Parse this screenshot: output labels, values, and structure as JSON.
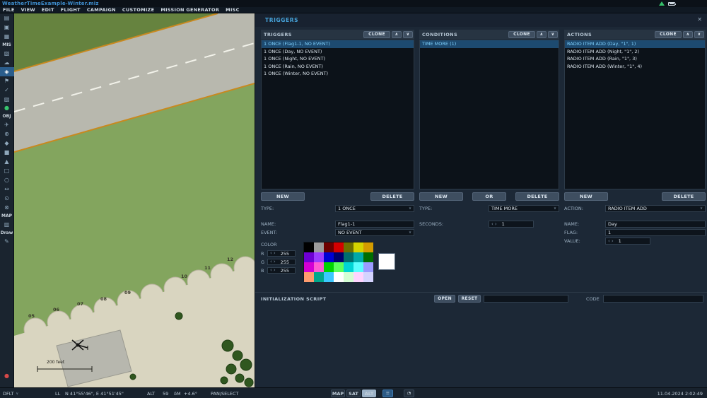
{
  "window": {
    "title": "WeatherTimeExample-Winter.miz"
  },
  "menu": {
    "items": [
      "FILE",
      "VIEW",
      "EDIT",
      "FLIGHT",
      "CAMPAIGN",
      "CUSTOMIZE",
      "MISSION GENERATOR",
      "MISC"
    ]
  },
  "ui": {
    "chevron": "∨",
    "up": "∧",
    "down": "∨",
    "dec": "‹",
    "inc": "›",
    "close": "✕",
    "grid_icon": "≡",
    "clock_icon": "◔"
  },
  "toolbar": {
    "items": [
      {
        "cls": "tb-icon",
        "name": "new-mission-icon",
        "glyph": "▤",
        "inter": "true"
      },
      {
        "cls": "tb-icon",
        "name": "open-mission-icon",
        "glyph": "▣",
        "inter": "true"
      },
      {
        "cls": "tb-icon",
        "name": "save-mission-icon",
        "glyph": "▦",
        "inter": "true"
      },
      {
        "cls": "tb-label",
        "name": "mis-section-label",
        "glyph": "MIS",
        "inter": "false"
      },
      {
        "cls": "tb-icon",
        "name": "briefing-icon",
        "glyph": "▧",
        "inter": "true"
      },
      {
        "cls": "tb-icon",
        "name": "weather-icon",
        "glyph": "☁",
        "inter": "true"
      },
      {
        "cls": "tb-icon-sel",
        "name": "triggers-icon",
        "glyph": "◈",
        "inter": "true"
      },
      {
        "cls": "tb-icon",
        "name": "goals-icon",
        "glyph": "⚑",
        "inter": "true"
      },
      {
        "cls": "tb-icon",
        "name": "checklist-icon",
        "glyph": "✓",
        "inter": "true"
      },
      {
        "cls": "tb-icon",
        "name": "resources-icon",
        "glyph": "▨",
        "inter": "true"
      },
      {
        "cls": "tb-dot-green",
        "name": "validation-status-icon",
        "glyph": "●",
        "inter": "false"
      },
      {
        "cls": "tb-label",
        "name": "obj-section-label",
        "glyph": "OBJ",
        "inter": "false"
      },
      {
        "cls": "tb-icon",
        "name": "aircraft-icon",
        "glyph": "✈",
        "inter": "true"
      },
      {
        "cls": "tb-icon",
        "name": "helicopter-group-icon",
        "glyph": "⊕",
        "inter": "true"
      },
      {
        "cls": "tb-icon",
        "name": "ship-icon",
        "glyph": "◆",
        "inter": "true"
      },
      {
        "cls": "tb-icon",
        "name": "vehicle-icon",
        "glyph": "■",
        "inter": "true"
      },
      {
        "cls": "tb-icon",
        "name": "static-object-icon",
        "glyph": "▲",
        "inter": "true"
      },
      {
        "cls": "tb-icon",
        "name": "template-icon",
        "glyph": "□",
        "inter": "true"
      },
      {
        "cls": "tb-icon",
        "name": "trigger-zone-icon",
        "glyph": "○",
        "inter": "true"
      },
      {
        "cls": "tb-icon",
        "name": "distance-tool-icon",
        "glyph": "↔",
        "inter": "true"
      },
      {
        "cls": "tb-icon",
        "name": "waypoint-icon",
        "glyph": "⊙",
        "inter": "true"
      },
      {
        "cls": "tb-icon",
        "name": "erase-icon",
        "glyph": "⊗",
        "inter": "true"
      },
      {
        "cls": "tb-label",
        "name": "map-section-label",
        "glyph": "MAP",
        "inter": "false"
      },
      {
        "cls": "tb-icon",
        "name": "map-options-icon",
        "glyph": "▥",
        "inter": "true"
      },
      {
        "cls": "tb-label",
        "name": "draw-section-label",
        "glyph": "Draw",
        "inter": "false"
      },
      {
        "cls": "tb-icon",
        "name": "draw-tool-icon",
        "glyph": "✎",
        "inter": "true"
      },
      {
        "cls": "tb-dot-red",
        "name": "record-indicator-icon",
        "glyph": "●",
        "inter": "false"
      }
    ]
  },
  "map": {
    "parking_numbers": [
      "05",
      "06",
      "07",
      "08",
      "09",
      "10",
      "11",
      "12"
    ],
    "scale_label": "200 feet"
  },
  "panel": {
    "title": "TRIGGERS",
    "triggers": {
      "header": "TRIGGERS",
      "clone": "CLONE",
      "items": [
        {
          "label": "1 ONCE (Flag1-1, NO EVENT)",
          "cls": "selected"
        },
        {
          "label": "1 ONCE (Day, NO EVENT)"
        },
        {
          "label": "1 ONCE (Night, NO EVENT)"
        },
        {
          "label": "1 ONCE (Rain, NO EVENT)"
        },
        {
          "label": "1 ONCE (Winter, NO EVENT)"
        }
      ],
      "new": "NEW",
      "delete": "DELETE",
      "type_label": "TYPE:",
      "type_value": "1 ONCE",
      "name_label": "NAME:",
      "name_value": "Flag1-1",
      "event_label": "EVENT:",
      "event_value": "NO EVENT",
      "color_label": "COLOR",
      "r": {
        "label": "R",
        "value": "255"
      },
      "g": {
        "label": "G",
        "value": "255"
      },
      "b": {
        "label": "B",
        "value": "255"
      },
      "selected_color": "#ffffff",
      "palette": [
        "#000000",
        "#9c9c9c",
        "#6e0000",
        "#d40000",
        "#6e6e00",
        "#d4d400",
        "#d49c00",
        "#6e00d4",
        "#9c3cff",
        "#0000d4",
        "#00006e",
        "#006e6e",
        "#00a8a8",
        "#006e00",
        "#d400d4",
        "#ff5cd4",
        "#00d400",
        "#5cff5c",
        "#00d4d4",
        "#5cffff",
        "#9c9cff",
        "#ff9c6e",
        "#00a88c",
        "#3cc8ff",
        "#ffffff",
        "#d4ffd4",
        "#ffd4ff",
        "#d4d4ff"
      ]
    },
    "conditions": {
      "header": "CONDITIONS",
      "clone": "CLONE",
      "items": [
        {
          "label": "TIME MORE (1)",
          "cls": "selected"
        }
      ],
      "new": "NEW",
      "or": "OR",
      "delete": "DELETE",
      "type_label": "TYPE:",
      "type_value": "TIME MORE",
      "seconds_label": "SECONDS:",
      "seconds_value": "1"
    },
    "actions": {
      "header": "ACTIONS",
      "clone": "CLONE",
      "items": [
        {
          "label": "RADIO ITEM ADD (Day, \"1\", 1)",
          "cls": "selected"
        },
        {
          "label": "RADIO ITEM ADD (Night, \"1\", 2)"
        },
        {
          "label": "RADIO ITEM ADD (Rain, \"1\", 3)"
        },
        {
          "label": "RADIO ITEM ADD (Winter, \"1\", 4)"
        }
      ],
      "new": "NEW",
      "delete": "DELETE",
      "action_label": "ACTION:",
      "action_value": "RADIO ITEM ADD",
      "name_label": "NAME:",
      "name_value": "Day",
      "flag_label": "FLAG:",
      "flag_value": "1",
      "value_label": "VALUE:",
      "value_value": "1"
    },
    "init_script": {
      "label": "INITIALIZATION SCRIPT",
      "open": "OPEN",
      "reset": "RESET",
      "script_value": "",
      "code_label": "CODE",
      "code_value": ""
    }
  },
  "statusbar": {
    "layer": "DFLT",
    "ll_label": "LL",
    "coords": "N 41°55'46\", E 41°51'45\"",
    "alt_label": "ALT",
    "alt_value": "59",
    "decl_label": "δM",
    "decl_value": "+4.6°",
    "mode": "PAN/SELECT",
    "map_btn": "MAP",
    "sat_btn": "SAT",
    "alt_btn": "ALT",
    "datetime": "11.04.2024 2:02:49"
  }
}
